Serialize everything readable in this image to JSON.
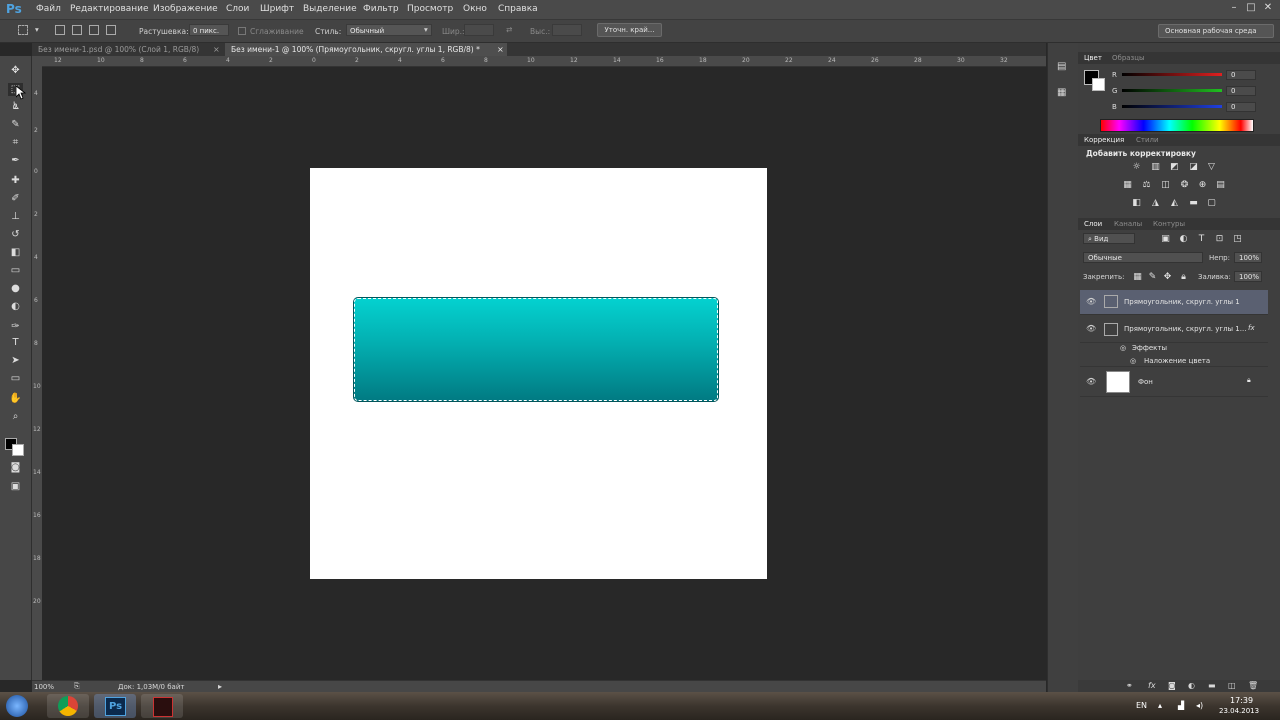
{
  "app": {
    "logo": "Ps"
  },
  "menu": [
    "Файл",
    "Редактирование",
    "Изображение",
    "Слои",
    "Шрифт",
    "Выделение",
    "Фильтр",
    "Просмотр",
    "Окно",
    "Справка"
  ],
  "window_controls": {
    "minimize": "–",
    "maximize": "□",
    "close": "✕"
  },
  "options": {
    "feather_label": "Растушевка:",
    "feather_value": "0 пикс.",
    "antialias_label": "Сглаживание",
    "style_label": "Стиль:",
    "style_value": "Обычный",
    "width_label": "Шир.:",
    "height_label": "Выс.:",
    "refine_button": "Уточн. край..."
  },
  "workspace": "Основная рабочая среда",
  "tabs": [
    {
      "label": "Без имени-1.psd @ 100% (Слой 1, RGB/8)",
      "close": "×"
    },
    {
      "label": "Без имени-1 @ 100% (Прямоугольник, скругл. углы 1, RGB/8) *",
      "close": "×"
    }
  ],
  "ruler_top": [
    "12",
    "10",
    "8",
    "6",
    "4",
    "2",
    "0",
    "2",
    "4",
    "6",
    "8",
    "10",
    "12",
    "14",
    "16",
    "18",
    "20",
    "22",
    "24",
    "26",
    "28",
    "30",
    "32"
  ],
  "ruler_left": [
    "4",
    "2",
    "0",
    "2",
    "4",
    "6",
    "8",
    "10",
    "12",
    "14",
    "16",
    "18",
    "20"
  ],
  "status": {
    "zoom": "100%",
    "doc": "Док: 1,03M/0 байт"
  },
  "color_panel": {
    "tabs": [
      "Цвет",
      "Образцы"
    ],
    "channels": [
      {
        "label": "R",
        "value": "0",
        "color": "#e02020"
      },
      {
        "label": "G",
        "value": "0",
        "color": "#20c020"
      },
      {
        "label": "B",
        "value": "0",
        "color": "#2040e0"
      }
    ]
  },
  "adjust_panel": {
    "tabs": [
      "Коррекция",
      "Стили"
    ],
    "title": "Добавить корректировку"
  },
  "layers_panel": {
    "tabs": [
      "Слои",
      "Каналы",
      "Контуры"
    ],
    "filter": "Вид",
    "blend_mode": "Обычные",
    "opacity_label": "Непр:",
    "opacity_value": "100%",
    "lock_label": "Закрепить:",
    "fill_label": "Заливка:",
    "fill_value": "100%",
    "layers": [
      {
        "name": "Прямоугольник, скругл. углы 1"
      },
      {
        "name": "Прямоугольник, скругл. углы 1..."
      },
      {
        "name": "Фон"
      }
    ],
    "effects_label": "Эффекты",
    "effect_item": "Наложение цвета"
  },
  "taskbar": {
    "lang": "EN",
    "time": "17:39",
    "date": "23.04.2013",
    "ps_label": "Ps"
  }
}
